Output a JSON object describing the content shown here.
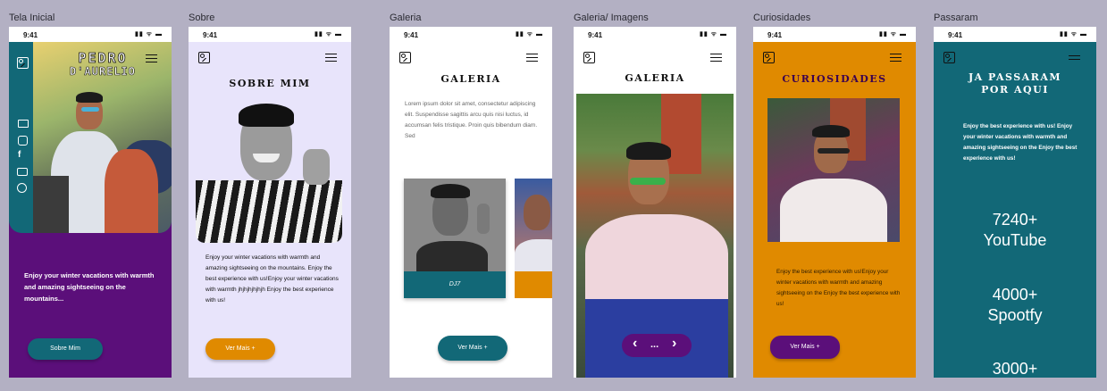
{
  "status": {
    "time": "9:41",
    "icons": "▮▮ ᯤ ▬"
  },
  "frames": [
    {
      "label": "Tela Inicial",
      "name_line1": "PEDRO",
      "name_line2": "D'AURELIO",
      "text": "Enjoy your winter vacations with warmth and amazing sightseeing on the mountains...",
      "button": "Sobre Mim"
    },
    {
      "label": "Sobre",
      "title": "SOBRE MIM",
      "text": "Enjoy your winter vacations with warmth and amazing sightseeing on the mountains. Enjoy the best experience with us!Enjoy your winter vacations with warmth jhjhjhjhjhjh Enjoy the best experience with us!",
      "button": "Ver Mais +"
    },
    {
      "label": "Galeria",
      "title": "GALERIA",
      "text": "Lorem ipsum dolor sit amet, consectetur adipiscing elit. Suspendisse sagittis arcu quis nisi luctus, id accumsan felis tristique. Proin quis bibendum diam. Sed",
      "card_caption": "DJ7",
      "button": "Ver Mais +"
    },
    {
      "label": "Galeria/ Imagens",
      "title": "GALERIA",
      "nav_prev": "‹",
      "nav_dots": "...",
      "nav_next": "›"
    },
    {
      "label": "Curiosidades",
      "title": "CURIOSIDADES",
      "text": "Enjoy the best experience with us!Enjoy your winter vacations with warmth and amazing sightseeing on the Enjoy the best experience with us!",
      "button": "Ver Mais +"
    },
    {
      "label": "Passaram",
      "title_line1": "JA PASSARAM",
      "title_line2": "POR AQUI",
      "text": "Enjoy the best experience with us! Enjoy your winter vacations with warmth and amazing sightseeing on the Enjoy the best experience with us!",
      "stats": [
        {
          "value": "7240+",
          "label": "YouTube"
        },
        {
          "value": "4000+",
          "label": "Spootfy"
        },
        {
          "value": "3000+",
          "label": ""
        }
      ]
    }
  ],
  "colors": {
    "purple": "#5b0f7a",
    "teal": "#126877",
    "orange": "#e08a00",
    "lavender": "#e8e4fb",
    "bg": "#b3b0c3"
  }
}
